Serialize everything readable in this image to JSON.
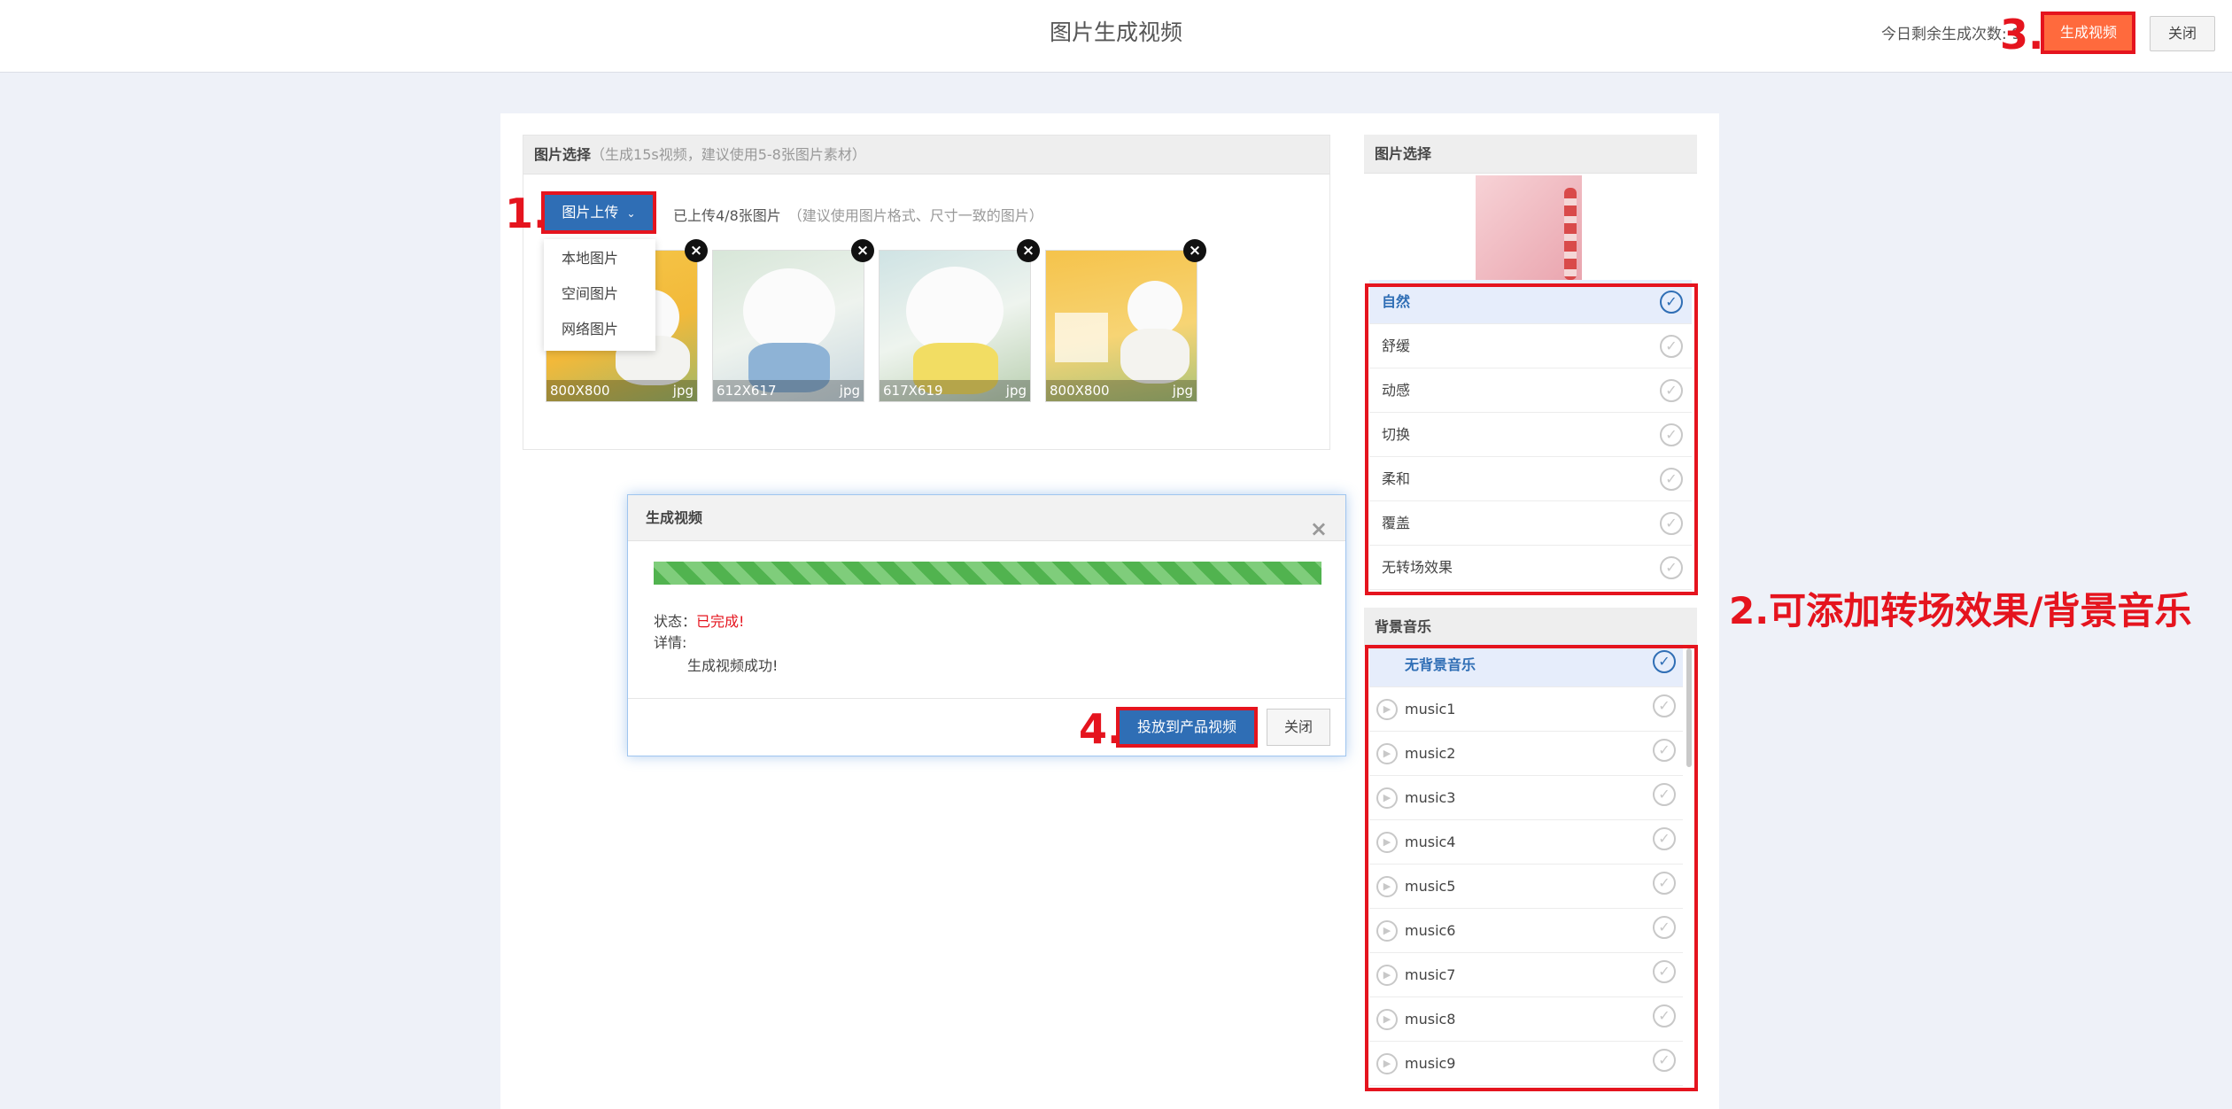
{
  "header": {
    "title": "图片生成视频",
    "remaining_label": "今日剩余生成次数: 9",
    "generate_button": "生成视频",
    "close_button": "关闭"
  },
  "annotations": {
    "step1": "1.",
    "step2": "2.可添加转场效果/背景音乐",
    "step3": "3.",
    "step4": "4.",
    "color": "#e5141e"
  },
  "upload": {
    "title": "图片选择",
    "hint": "（生成15s视频，建议使用5-8张图片素材）",
    "button_label": "图片上传",
    "uploaded_count": "已上传4/8张图片",
    "uploaded_hint": "（建议使用图片格式、尺寸一致的图片）",
    "dropdown": [
      "本地图片",
      "空间图片",
      "网络图片"
    ],
    "images": [
      {
        "dims": "800X800",
        "ext": "jpg"
      },
      {
        "dims": "612X617",
        "ext": "jpg"
      },
      {
        "dims": "617X619",
        "ext": "jpg"
      },
      {
        "dims": "800X800",
        "ext": "jpg"
      }
    ]
  },
  "transition": {
    "title": "图片选择",
    "effects": [
      "自然",
      "舒缓",
      "动感",
      "切换",
      "柔和",
      "覆盖",
      "无转场效果"
    ],
    "selected": "自然"
  },
  "music": {
    "title": "背景音乐",
    "items": [
      "无背景音乐",
      "music1",
      "music2",
      "music3",
      "music4",
      "music5",
      "music6",
      "music7",
      "music8",
      "music9"
    ],
    "selected": "无背景音乐"
  },
  "dialog": {
    "title": "生成视频",
    "status_label": "状态：",
    "status_value": "已完成!",
    "detail_label": "详情:",
    "detail_text": "生成视频成功!",
    "progress": 1.0,
    "push_button": "投放到产品视频",
    "close_button": "关闭"
  },
  "colors": {
    "primary": "#2f6eb5",
    "generate": "#ff6a3d",
    "progress": "#51b34f",
    "selected_bg": "#e6edfb"
  }
}
